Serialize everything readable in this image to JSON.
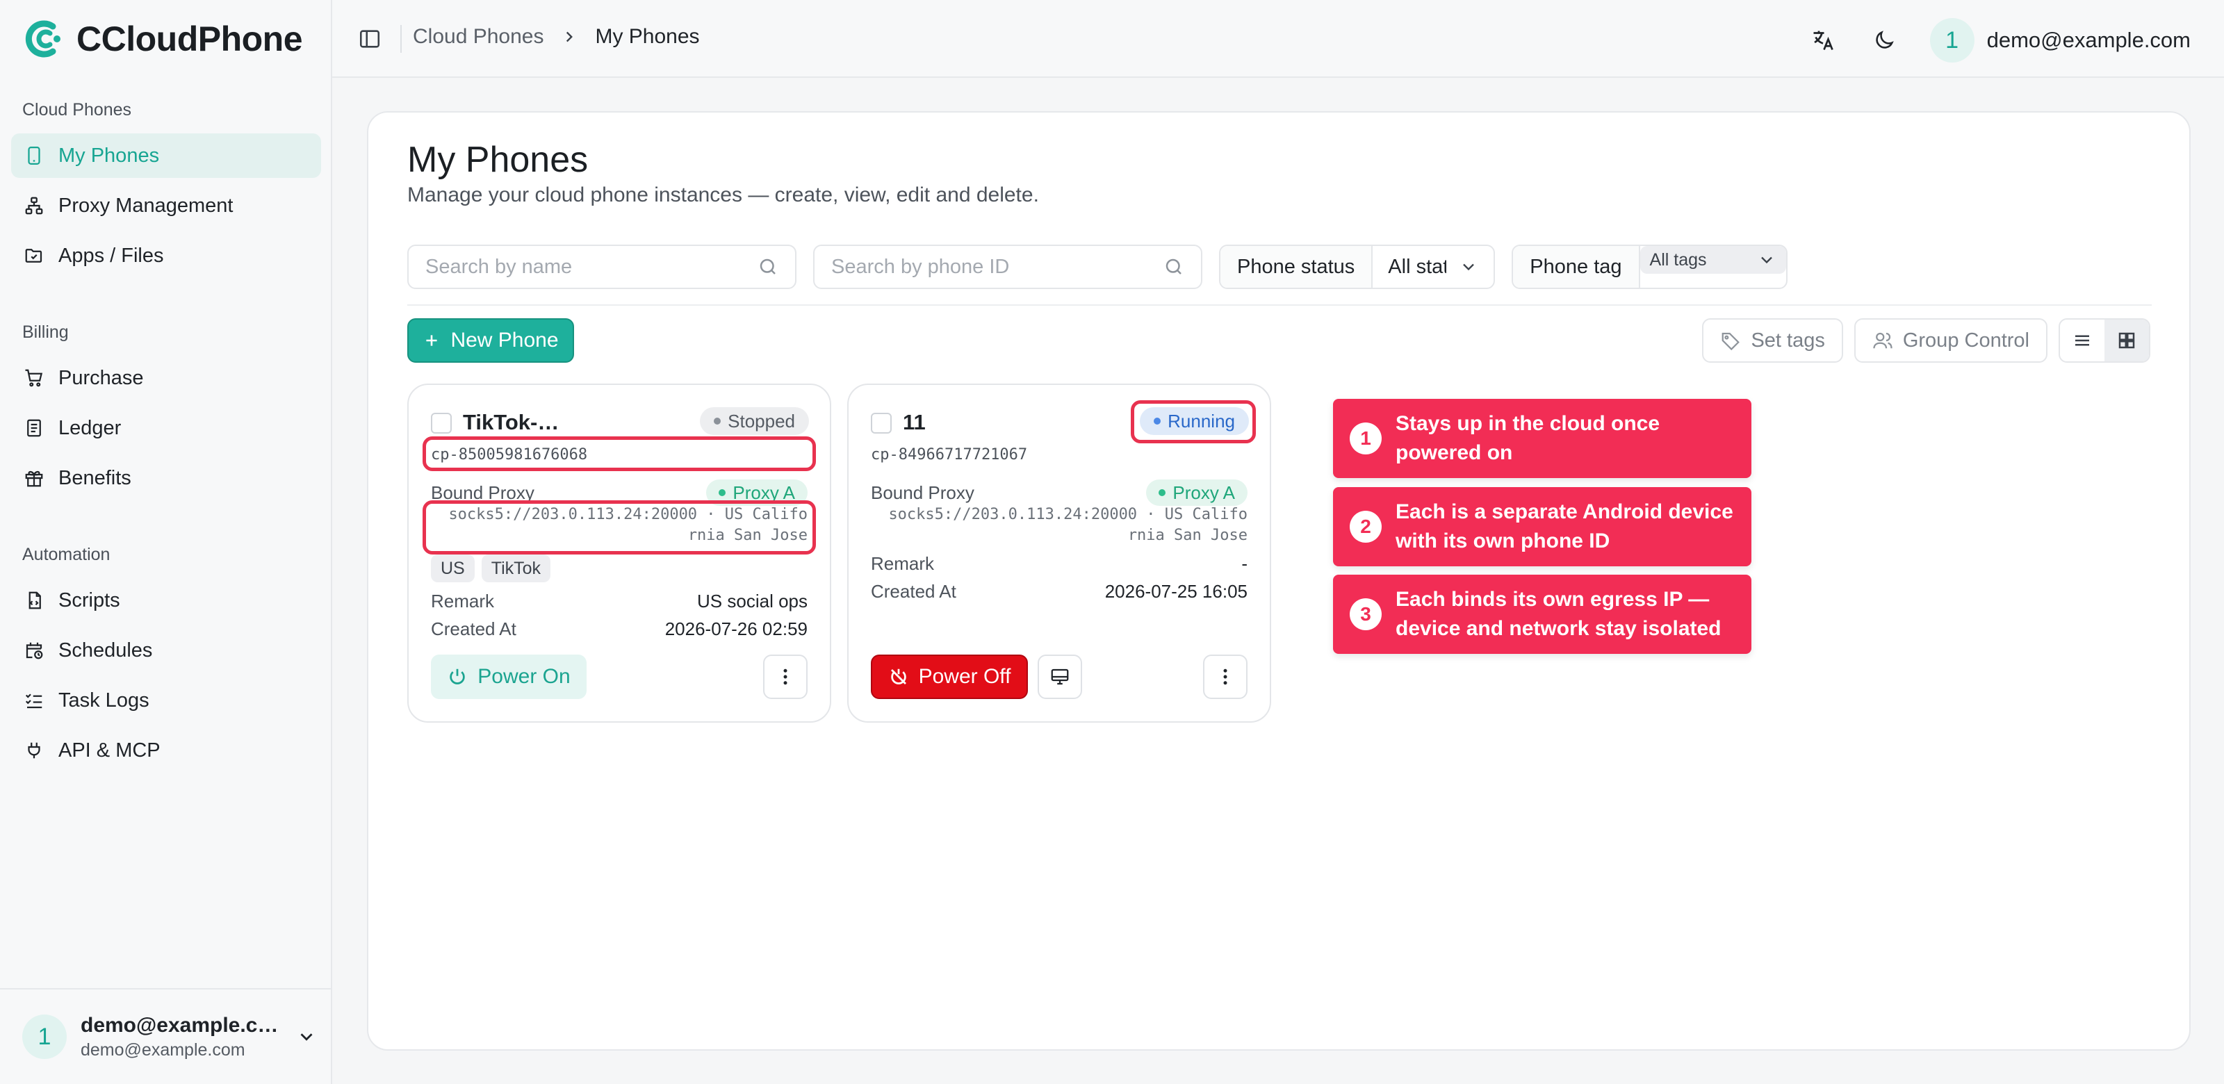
{
  "app": {
    "name": "CCloudPhone"
  },
  "sidebar": {
    "groups": [
      {
        "title": "Cloud Phones",
        "items": [
          {
            "label": "My Phones",
            "icon": "phone-icon",
            "active": true
          },
          {
            "label": "Proxy Management",
            "icon": "network-icon"
          },
          {
            "label": "Apps / Files",
            "icon": "folder-icon"
          }
        ]
      },
      {
        "title": "Billing",
        "items": [
          {
            "label": "Purchase",
            "icon": "cart-icon"
          },
          {
            "label": "Ledger",
            "icon": "ledger-icon"
          },
          {
            "label": "Benefits",
            "icon": "gift-icon"
          }
        ]
      },
      {
        "title": "Automation",
        "items": [
          {
            "label": "Scripts",
            "icon": "script-icon"
          },
          {
            "label": "Schedules",
            "icon": "calendar-clock-icon"
          },
          {
            "label": "Task Logs",
            "icon": "checklist-icon"
          },
          {
            "label": "API & MCP",
            "icon": "plug-icon"
          }
        ]
      }
    ],
    "footer": {
      "avatar": "1",
      "name": "demo@example.com",
      "email": "demo@example.com"
    }
  },
  "header": {
    "breadcrumb": {
      "parent": "Cloud Phones",
      "current": "My Phones"
    },
    "user": {
      "avatar": "1",
      "email": "demo@example.com"
    }
  },
  "page": {
    "title": "My Phones",
    "subtitle": "Manage your cloud phone instances — create, view, edit and delete."
  },
  "filters": {
    "search_name_placeholder": "Search by name",
    "search_id_placeholder": "Search by phone ID",
    "status_label": "Phone status",
    "status_value": "All status",
    "tag_label": "Phone tag",
    "tag_value": "All tags"
  },
  "toolbar": {
    "new_phone": "New Phone",
    "set_tags": "Set tags",
    "group_control": "Group Control"
  },
  "phones": [
    {
      "name": "TikTok-US social ops",
      "status": "Stopped",
      "phone_id": "cp-85005981676068",
      "bound_proxy_label": "Bound Proxy",
      "proxy_name": "Proxy A",
      "proxy_url": "socks5://203.0.113.24:20000 · US California San Jose",
      "tags": [
        "US",
        "TikTok"
      ],
      "remark_label": "Remark",
      "remark": "US social ops",
      "created_label": "Created At",
      "created_at": "2026-07-26 02:59",
      "action": "Power On"
    },
    {
      "name": "11",
      "status": "Running",
      "phone_id": "cp-84966717721067",
      "bound_proxy_label": "Bound Proxy",
      "proxy_name": "Proxy A",
      "proxy_url": "socks5://203.0.113.24:20000 · US California San Jose",
      "tags": [],
      "remark_label": "Remark",
      "remark": "-",
      "created_label": "Created At",
      "created_at": "2026-07-25 16:05",
      "action": "Power Off"
    }
  ],
  "callouts": [
    {
      "num": "1",
      "text": "Stays up in the cloud once powered on"
    },
    {
      "num": "2",
      "text": "Each is a separate Android device with its own phone ID"
    },
    {
      "num": "3",
      "text": "Each binds its own egress IP — device and network stay isolated"
    }
  ],
  "colors": {
    "accent": "#1eb09c",
    "danger": "#e20d17",
    "highlight": "#e8324f",
    "callout": "#f22d55"
  }
}
